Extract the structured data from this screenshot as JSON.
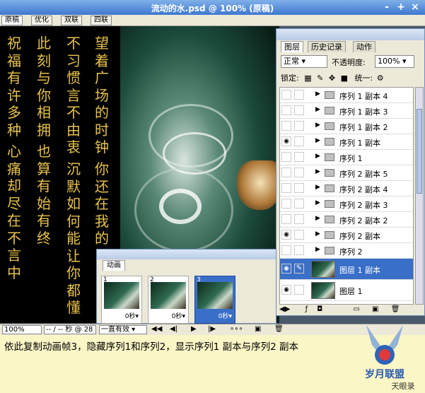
{
  "window": {
    "title": "流动的水.psd @ 100% (原稿)",
    "buttons": [
      "-",
      "+",
      "×"
    ]
  },
  "doc_tabs": [
    "原稿",
    "优化",
    "双联",
    "四联"
  ],
  "poem_columns": [
    "望着广场的时钟",
    "你还在我的",
    "不习惯言不由衷",
    "沉默如何能让你都懂",
    "此刻与你相拥",
    "也算有始有终",
    "祝福有许多种",
    "心痛却尽在不言中"
  ],
  "animation_panel": {
    "tab": "动画",
    "frames": [
      {
        "num": "1",
        "duration": "0秒▾"
      },
      {
        "num": "2",
        "duration": "0秒▾"
      },
      {
        "num": "3",
        "duration": "0秒▾"
      }
    ],
    "loop": "一直有效 ▾"
  },
  "status_bar": {
    "zoom": "100%",
    "time": "-- / -- 秒 @ 28",
    "controls": [
      "◀◀",
      "◀|",
      "▶",
      "|▶"
    ]
  },
  "layers_panel": {
    "tabs": [
      "图层",
      "历史记录",
      "动作"
    ],
    "blend_mode": "正常",
    "opacity_label": "不透明度:",
    "opacity_value": "100%",
    "lock_label": "锁定:",
    "unify_label": "统一:",
    "layers": [
      {
        "name": "序列 1 副本 4",
        "visible": false,
        "type": "group"
      },
      {
        "name": "序列 1 副本 3",
        "visible": false,
        "type": "group"
      },
      {
        "name": "序列 1 副本 2",
        "visible": false,
        "type": "group"
      },
      {
        "name": "序列 1 副本",
        "visible": true,
        "type": "group"
      },
      {
        "name": "序列 1",
        "visible": false,
        "type": "group"
      },
      {
        "name": "序列 2 副本 5",
        "visible": false,
        "type": "group"
      },
      {
        "name": "序列 2 副本 4",
        "visible": false,
        "type": "group"
      },
      {
        "name": "序列 2 副本 3",
        "visible": false,
        "type": "group"
      },
      {
        "name": "序列 2 副本 2",
        "visible": false,
        "type": "group"
      },
      {
        "name": "序列 2 副本",
        "visible": true,
        "type": "group"
      },
      {
        "name": "序列 2",
        "visible": false,
        "type": "group"
      },
      {
        "name": "图层 1 副本",
        "visible": true,
        "type": "layer",
        "selected": true
      },
      {
        "name": "图层 1",
        "visible": true,
        "type": "layer"
      }
    ]
  },
  "caption": "依此复制动画帧3，隐藏序列1和序列2，显示序列1 副本与序列2 副本",
  "logo": {
    "text1": "岁月联盟",
    "text2": "天眼录"
  }
}
